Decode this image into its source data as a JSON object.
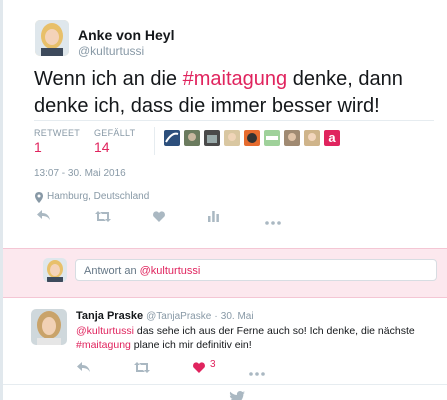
{
  "tweet": {
    "author_name": "Anke von Heyl",
    "author_handle": "@kulturtussi",
    "text_part1": "Wenn ich an die ",
    "hashtag": "#maitagung",
    "text_part2": " denke, dann denke ich, dass die immer besser wird!",
    "retweets_label": "RETWEET",
    "retweets_count": "1",
    "likes_label": "GEFÄLLT",
    "likes_count": "14",
    "timestamp": "13:07 - 30. Mai 2016",
    "location": "Hamburg, Deutschland",
    "liked_by_icons": [
      "avatar-1",
      "avatar-2",
      "avatar-3",
      "avatar-4",
      "avatar-5",
      "avatar-6",
      "avatar-7",
      "avatar-8",
      "a-logo"
    ]
  },
  "reply_box": {
    "prefix": "Antwort an ",
    "mention": "@kulturtussi"
  },
  "reply": {
    "author_name": "Tanja Praske",
    "author_handle": "@TanjaPraske",
    "separator": "·",
    "date": "30. Mai",
    "mention": "@kulturtussi",
    "text1": " das sehe ich aus der Ferne auch so! Ich denke, die nächste ",
    "hashtag": "#maitagung",
    "text2": " plane ich mir definitiv ein!",
    "like_count": "3"
  },
  "colors": {
    "accent": "#e0245e",
    "muted": "#8899a6",
    "icon": "#aab8c2"
  }
}
